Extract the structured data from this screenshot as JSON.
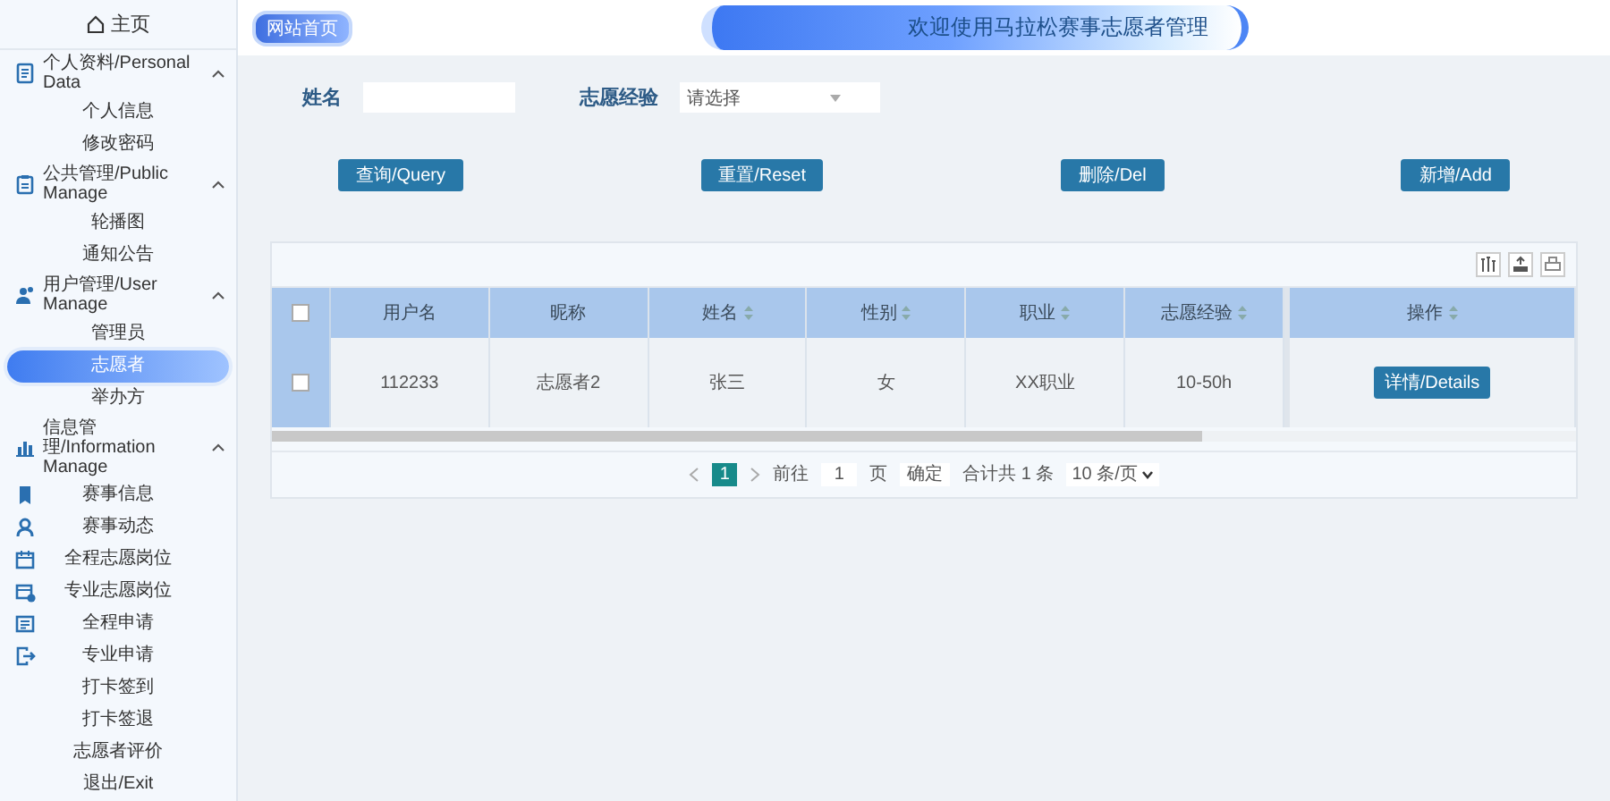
{
  "sidebar": {
    "home_label": "主页",
    "groups": [
      {
        "label": "个人资料/Personal Data",
        "expanded": true,
        "items": [
          {
            "label": "个人信息",
            "selected": false
          },
          {
            "label": "修改密码",
            "selected": false
          }
        ]
      },
      {
        "label": "公共管理/Public Manage",
        "expanded": true,
        "items": [
          {
            "label": "轮播图",
            "selected": false
          },
          {
            "label": "通知公告",
            "selected": false
          }
        ]
      },
      {
        "label": "用户管理/User Manage",
        "expanded": true,
        "items": [
          {
            "label": "管理员",
            "selected": false
          },
          {
            "label": "志愿者",
            "selected": true
          },
          {
            "label": "举办方",
            "selected": false
          }
        ]
      },
      {
        "label": "信息管理/Information Manage",
        "expanded": true,
        "items": [
          {
            "label": "赛事信息",
            "selected": false
          },
          {
            "label": "赛事动态",
            "selected": false
          },
          {
            "label": "全程志愿岗位",
            "selected": false
          },
          {
            "label": "专业志愿岗位",
            "selected": false
          },
          {
            "label": "全程申请",
            "selected": false
          },
          {
            "label": "专业申请",
            "selected": false
          },
          {
            "label": "打卡签到",
            "selected": false
          },
          {
            "label": "打卡签退",
            "selected": false
          },
          {
            "label": "志愿者评价",
            "selected": false
          },
          {
            "label": "退出/Exit",
            "selected": false
          }
        ]
      }
    ]
  },
  "header": {
    "home_link": "网站首页",
    "title": "欢迎使用马拉松赛事志愿者管理"
  },
  "search": {
    "fields": [
      {
        "kind": "text",
        "label": "姓名"
      },
      {
        "kind": "select",
        "label": "志愿经验",
        "placeholder": "请选择"
      }
    ]
  },
  "actions": [
    "查询/Query",
    "重置/Reset",
    "删除/Del",
    "新增/Add"
  ],
  "table": {
    "select_all": {
      "checked": false
    },
    "columns": [
      {
        "label": "用户名",
        "sortable": false
      },
      {
        "label": "昵称",
        "sortable": false
      },
      {
        "label": "姓名",
        "sortable": true
      },
      {
        "label": "性别",
        "sortable": true
      },
      {
        "label": "职业",
        "sortable": true
      },
      {
        "label": "志愿经验",
        "sortable": true
      }
    ],
    "action_column": {
      "label": "操作",
      "sortable": true
    },
    "rows": [
      {
        "checked": false,
        "cells": [
          "112233",
          "志愿者2",
          "张三",
          "女",
          "XX职业",
          "10-50h"
        ],
        "action": "详情/Details"
      }
    ]
  },
  "pagination": {
    "pages": [
      {
        "label": "1",
        "selected": true
      }
    ],
    "goto_label": "前往",
    "goto_value": "1",
    "page_unit": "页",
    "confirm": "确定",
    "total": "合计共 1 条",
    "page_size": "10 条/页"
  }
}
